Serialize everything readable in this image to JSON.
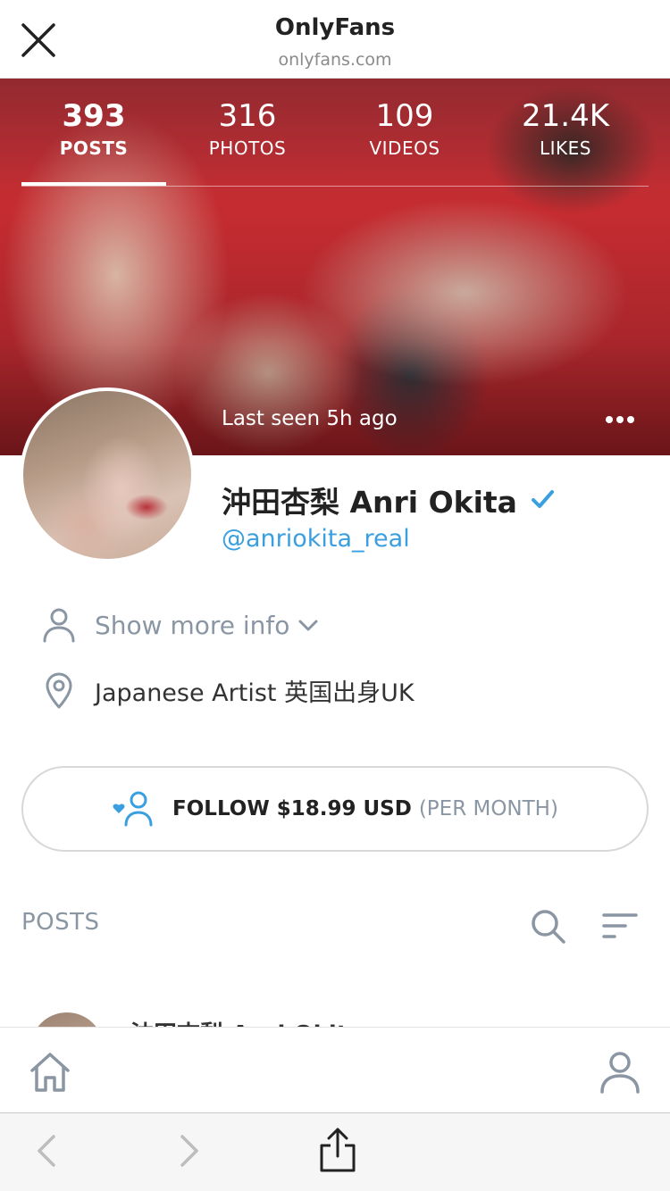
{
  "browser": {
    "title": "OnlyFans",
    "url": "onlyfans.com"
  },
  "stats": [
    {
      "value": "393",
      "label": "POSTS",
      "active": true
    },
    {
      "value": "316",
      "label": "PHOTOS",
      "active": false
    },
    {
      "value": "109",
      "label": "VIDEOS",
      "active": false
    },
    {
      "value": "21.4K",
      "label": "LIKES",
      "active": false
    }
  ],
  "profile": {
    "last_seen": "Last seen 5h ago",
    "name": "沖田杏梨 Anri Okita",
    "handle": "@anriokita_real",
    "verified": true,
    "show_more": "Show more info",
    "location": "Japanese Artist 英国出身UK"
  },
  "follow": {
    "label": "FOLLOW $18.99 USD",
    "period": "(PER MONTH)"
  },
  "posts": {
    "heading": "POSTS",
    "preview_author": "沖田杏梨 Anri Okita"
  },
  "colors": {
    "accent": "#3a9fe0",
    "muted": "#8a96a3"
  }
}
